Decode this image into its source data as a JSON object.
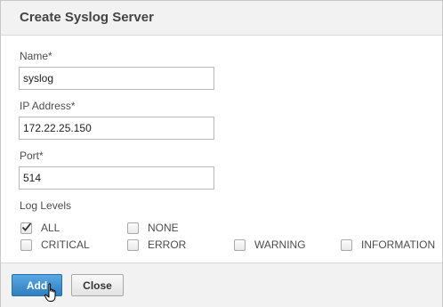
{
  "dialog": {
    "title": "Create Syslog Server"
  },
  "form": {
    "name": {
      "label": "Name*",
      "value": "syslog"
    },
    "ip": {
      "label": "IP Address*",
      "value": "172.22.25.150"
    },
    "port": {
      "label": "Port*",
      "value": "514"
    },
    "log_levels": {
      "label": "Log Levels",
      "options": [
        {
          "label": "ALL",
          "checked": true
        },
        {
          "label": "NONE",
          "checked": false
        },
        {
          "label": "CRITICAL",
          "checked": false
        },
        {
          "label": "ERROR",
          "checked": false
        },
        {
          "label": "WARNING",
          "checked": false
        },
        {
          "label": "INFORMATION",
          "checked": false
        }
      ]
    }
  },
  "footer": {
    "add_label": "Add",
    "close_label": "Close"
  },
  "colors": {
    "primary_button": "#2d7fc1",
    "header_bg": "#f2f2f2"
  }
}
